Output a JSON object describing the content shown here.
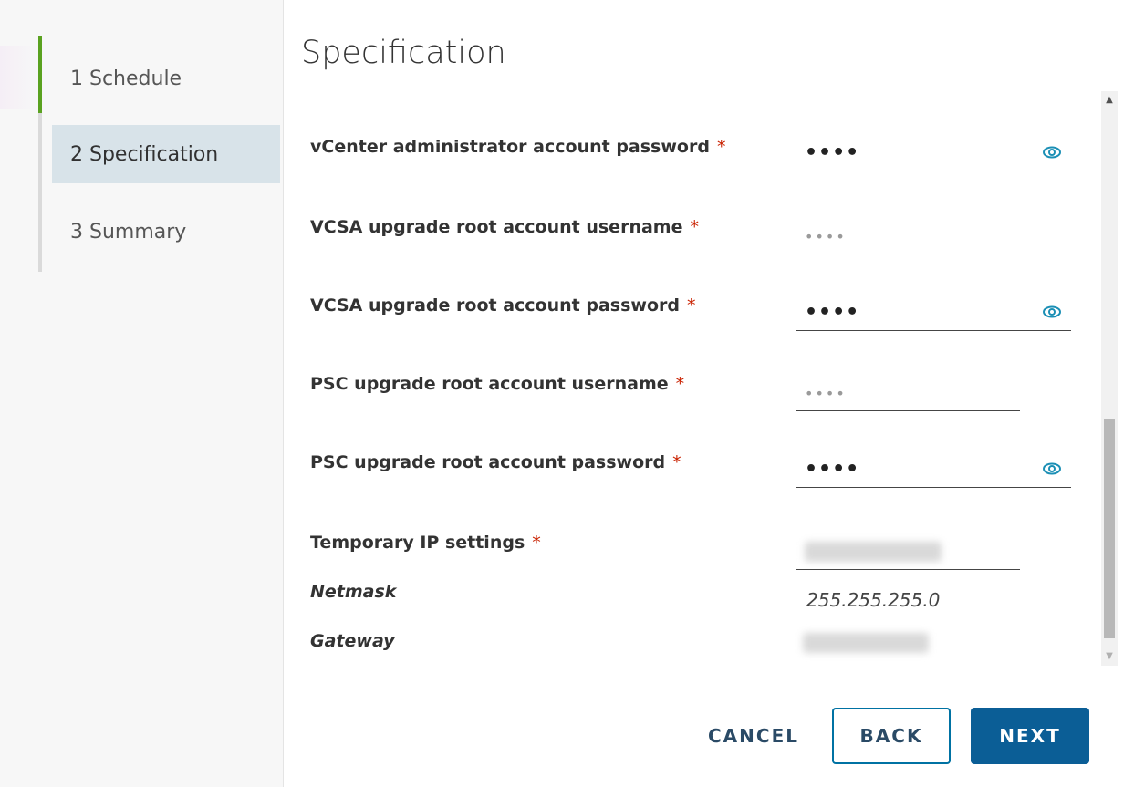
{
  "steps": [
    {
      "label": "1 Schedule"
    },
    {
      "label": "2 Specification"
    },
    {
      "label": "3 Summary"
    }
  ],
  "page": {
    "title": "Specification"
  },
  "fields": [
    {
      "label": "vCenter administrator account password",
      "required": "*",
      "value": "••••"
    },
    {
      "label": "VCSA upgrade root account username",
      "required": "*",
      "value": "••••"
    },
    {
      "label": "VCSA upgrade root account password",
      "required": "*",
      "value": "••••"
    },
    {
      "label": "PSC upgrade root account username",
      "required": "*",
      "value": "••••"
    },
    {
      "label": "PSC upgrade root account password",
      "required": "*",
      "value": "••••"
    },
    {
      "label": "Temporary IP settings",
      "required": "*",
      "value": ""
    }
  ],
  "ip_settings": {
    "netmask_label": "Netmask",
    "netmask_value": "255.255.255.0",
    "gateway_label": "Gateway"
  },
  "buttons": {
    "cancel": "CANCEL",
    "back": "BACK",
    "next": "NEXT"
  },
  "icons": {
    "eye": "eye-icon",
    "scroll_up": "scroll-up-arrow",
    "scroll_down": "scroll-down-arrow"
  },
  "colors": {
    "accent": "#0b5e96",
    "progress": "#5aa220",
    "required": "#c92100",
    "active_step": "#d8e3e9"
  }
}
